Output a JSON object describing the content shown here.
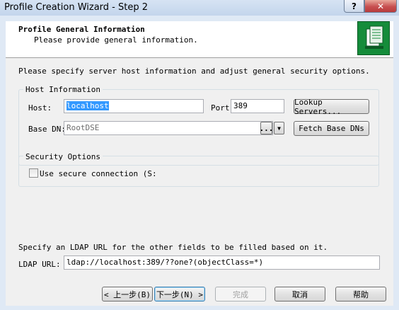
{
  "window": {
    "title": "Profile Creation Wizard - Step 2",
    "help_glyph": "?",
    "close_glyph": "✕"
  },
  "header": {
    "title": "Profile General Information",
    "subtitle": "Please provide general information."
  },
  "intro": "Please specify server host information and adjust general security options.",
  "host_info": {
    "legend": "Host Information",
    "host_label": "Host:",
    "host_value": "localhost",
    "port_label": "Port",
    "port_value": "389",
    "lookup_label": "Lookup Servers...",
    "basedn_label": "Base DN:",
    "basedn_value": "RootDSE",
    "browse_label": "...",
    "dropdown_glyph": "▼",
    "fetch_label": "Fetch Base DNs"
  },
  "security": {
    "legend": "Security Options",
    "checkbox_label": "Use secure connection (S:",
    "checked": false
  },
  "ldap": {
    "hint": "Specify an LDAP URL for the other fields to be filled based on it.",
    "label": "LDAP URL:",
    "value": "ldap://localhost:389/??one?(objectClass=*)"
  },
  "buttons": {
    "back": "< 上一步(B)",
    "next": "下一步(N) >",
    "finish": "完成",
    "cancel": "取消",
    "help": "帮助"
  },
  "colors": {
    "logo": "#158c3a",
    "selection": "#3399ff"
  }
}
